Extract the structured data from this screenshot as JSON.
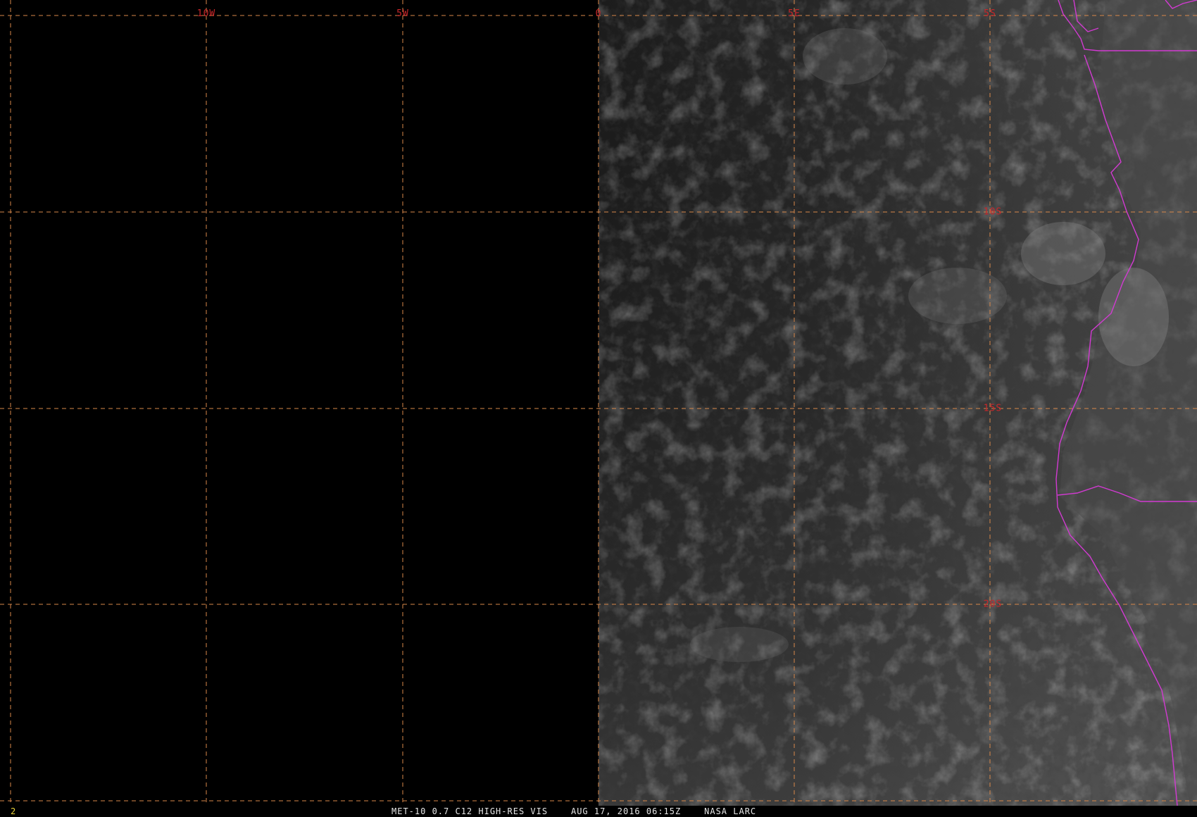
{
  "map": {
    "lon_labels": [
      {
        "text": "10W",
        "lon": -10
      },
      {
        "text": "5W",
        "lon": -5
      },
      {
        "text": "0",
        "lon": 0
      },
      {
        "text": "5E",
        "lon": 5
      },
      {
        "text": "5S",
        "lon": 10
      }
    ],
    "lat_labels": [
      {
        "text": "10S",
        "lat": -10
      },
      {
        "text": "15S",
        "lat": -15
      },
      {
        "text": "20S",
        "lat": -20
      }
    ],
    "gridline_color": "#d8884a",
    "coastline_color": "#d23ad2",
    "label_color": "#c8262a"
  },
  "footer": {
    "frame_number": "2",
    "caption": "MET-10 0.7 C12 HIGH-RES VIS    AUG 17, 2016 06:15Z    NASA LARC"
  }
}
